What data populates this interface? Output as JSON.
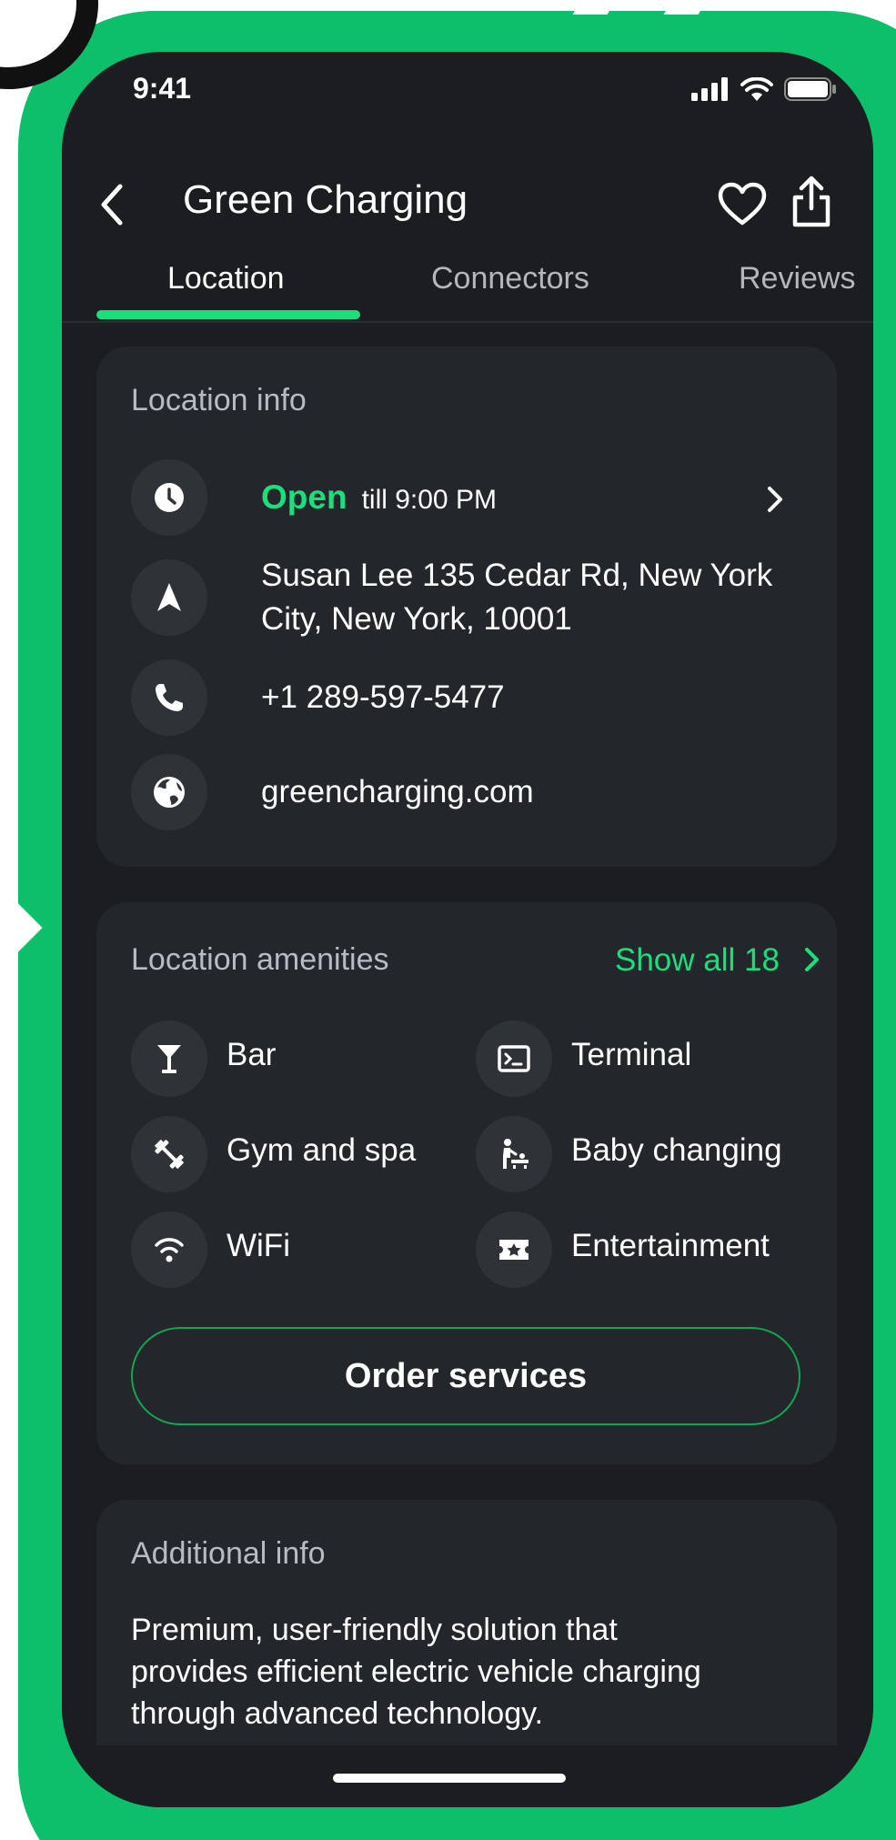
{
  "status_bar": {
    "time": "9:41"
  },
  "header": {
    "title": "Green Charging"
  },
  "tabs": [
    {
      "label": "Location"
    },
    {
      "label": "Connectors"
    },
    {
      "label": "Reviews"
    }
  ],
  "location_info": {
    "heading": "Location info",
    "open_label": "Open",
    "hours": "till 9:00 PM",
    "address_line1": "Susan Lee 135 Cedar Rd, New York",
    "address_line2": "City, New York, 10001",
    "phone": "+1 289-597-5477",
    "website": "greencharging.com"
  },
  "amenities": {
    "heading": "Location amenities",
    "show_all": "Show all 18",
    "items": [
      {
        "label": "Bar",
        "icon": "cocktail-icon"
      },
      {
        "label": "Terminal",
        "icon": "terminal-icon"
      },
      {
        "label": "Gym and spa",
        "icon": "dumbbell-icon"
      },
      {
        "label": "Baby changing",
        "icon": "baby-changing-icon"
      },
      {
        "label": "WiFi",
        "icon": "wifi-icon"
      },
      {
        "label": "Entertainment",
        "icon": "ticket-star-icon"
      }
    ],
    "order_button": "Order services"
  },
  "additional_info": {
    "heading": "Additional info",
    "line1": "Premium, user-friendly solution that",
    "line2": "provides efficient electric vehicle charging",
    "line3": "through advanced technology."
  },
  "colors": {
    "accent": "#19e07c",
    "background_green": "#0cc06b",
    "phone_bg": "#1b1d21",
    "card_bg": "#23272b"
  }
}
